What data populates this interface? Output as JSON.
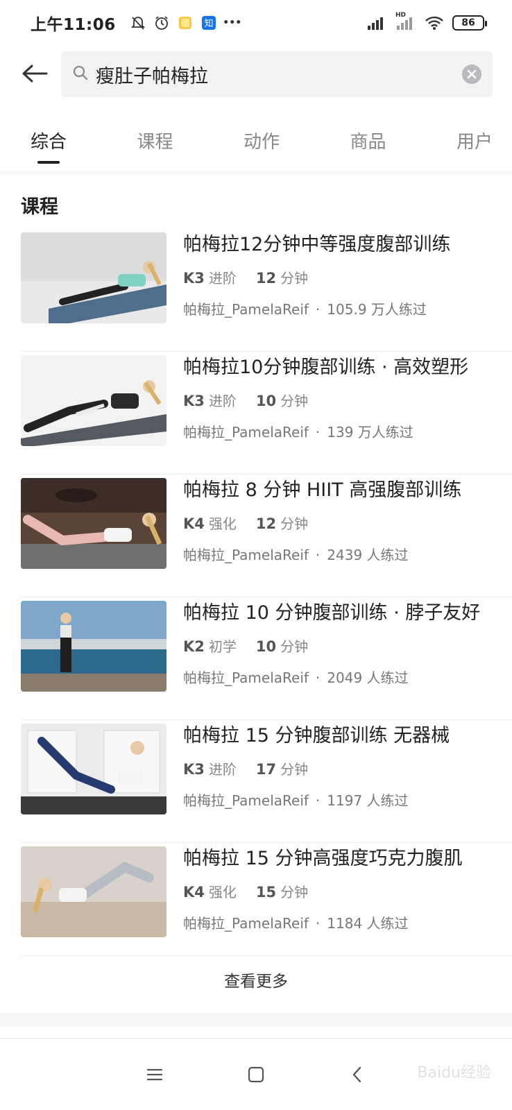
{
  "status_bar": {
    "time": "上午11:06",
    "icons": [
      "mute-bell-icon",
      "alarm-icon",
      "notes-app-icon",
      "zhihu-app-icon",
      "more-dots-icon"
    ],
    "zhihu_glyph": "知",
    "more_glyph": "•••",
    "hd_label": "HD",
    "battery": "86"
  },
  "search": {
    "query": "瘦肚子帕梅拉"
  },
  "tabs": [
    {
      "label": "综合",
      "active": true
    },
    {
      "label": "课程",
      "active": false
    },
    {
      "label": "动作",
      "active": false
    },
    {
      "label": "商品",
      "active": false
    },
    {
      "label": "用户",
      "active": false
    }
  ],
  "section_title": "课程",
  "courses": [
    {
      "title": "帕梅拉12分钟中等强度腹部训练",
      "level": "K3",
      "level_word": "进阶",
      "duration": "12",
      "duration_unit": "分钟",
      "author": "帕梅拉_PamelaReif",
      "separator": "·",
      "trained": "105.9 万人练过"
    },
    {
      "title": "帕梅拉10分钟腹部训练 · 高效塑形",
      "level": "K3",
      "level_word": "进阶",
      "duration": "10",
      "duration_unit": "分钟",
      "author": "帕梅拉_PamelaReif",
      "separator": "·",
      "trained": "139 万人练过"
    },
    {
      "title": "帕梅拉 8 分钟 HIIT 高强腹部训练",
      "level": "K4",
      "level_word": "强化",
      "duration": "12",
      "duration_unit": "分钟",
      "author": "帕梅拉_PamelaReif",
      "separator": "·",
      "trained": "2439 人练过"
    },
    {
      "title": "帕梅拉 10 分钟腹部训练 · 脖子友好",
      "level": "K2",
      "level_word": "初学",
      "duration": "10",
      "duration_unit": "分钟",
      "author": "帕梅拉_PamelaReif",
      "separator": "·",
      "trained": "2049 人练过"
    },
    {
      "title": "帕梅拉 15 分钟腹部训练 无器械",
      "level": "K3",
      "level_word": "进阶",
      "duration": "17",
      "duration_unit": "分钟",
      "author": "帕梅拉_PamelaReif",
      "separator": "·",
      "trained": "1197 人练过"
    },
    {
      "title": "帕梅拉 15 分钟高强度巧克力腹肌",
      "level": "K4",
      "level_word": "强化",
      "duration": "15",
      "duration_unit": "分钟",
      "author": "帕梅拉_PamelaReif",
      "separator": "·",
      "trained": "1184 人练过"
    }
  ],
  "more_label": "查看更多",
  "watermark": "Baidu经验",
  "colors": {
    "text_primary": "#222222",
    "text_secondary": "#777777",
    "search_bg": "#f2f2f3",
    "divider": "#ececec"
  }
}
